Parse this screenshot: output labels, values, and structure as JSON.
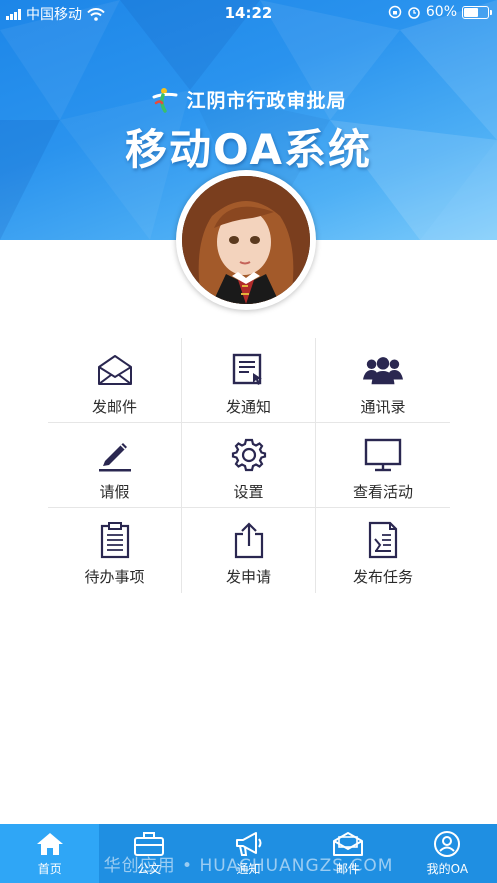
{
  "status_bar": {
    "carrier": "中国移动",
    "time": "14:22",
    "battery": "60%"
  },
  "header": {
    "org_name": "江阴市行政审批局",
    "app_title": "移动OA系统"
  },
  "menu": [
    {
      "label": "发邮件",
      "icon": "envelope-icon"
    },
    {
      "label": "发通知",
      "icon": "notice-document-icon"
    },
    {
      "label": "通讯录",
      "icon": "contacts-group-icon"
    },
    {
      "label": "请假",
      "icon": "pencil-icon"
    },
    {
      "label": "设置",
      "icon": "gear-icon"
    },
    {
      "label": "查看活动",
      "icon": "monitor-icon"
    },
    {
      "label": "待办事项",
      "icon": "clipboard-icon"
    },
    {
      "label": "发申请",
      "icon": "share-upload-icon"
    },
    {
      "label": "发布任务",
      "icon": "task-document-icon"
    }
  ],
  "tabs": [
    {
      "label": "首页",
      "icon": "home-icon",
      "active": true
    },
    {
      "label": "公文",
      "icon": "briefcase-icon",
      "active": false
    },
    {
      "label": "通知",
      "icon": "megaphone-icon",
      "active": false
    },
    {
      "label": "邮件",
      "icon": "mail-icon",
      "active": false
    },
    {
      "label": "我的OA",
      "icon": "user-icon",
      "active": false
    }
  ],
  "watermark": "华创应用 • HUACHUANGZS.COM",
  "colors": {
    "header_blue": "#1d86e8",
    "tabbar_blue": "#1f8fe2",
    "tab_active": "#2fa6f6",
    "icon_navy": "#2a2750"
  }
}
